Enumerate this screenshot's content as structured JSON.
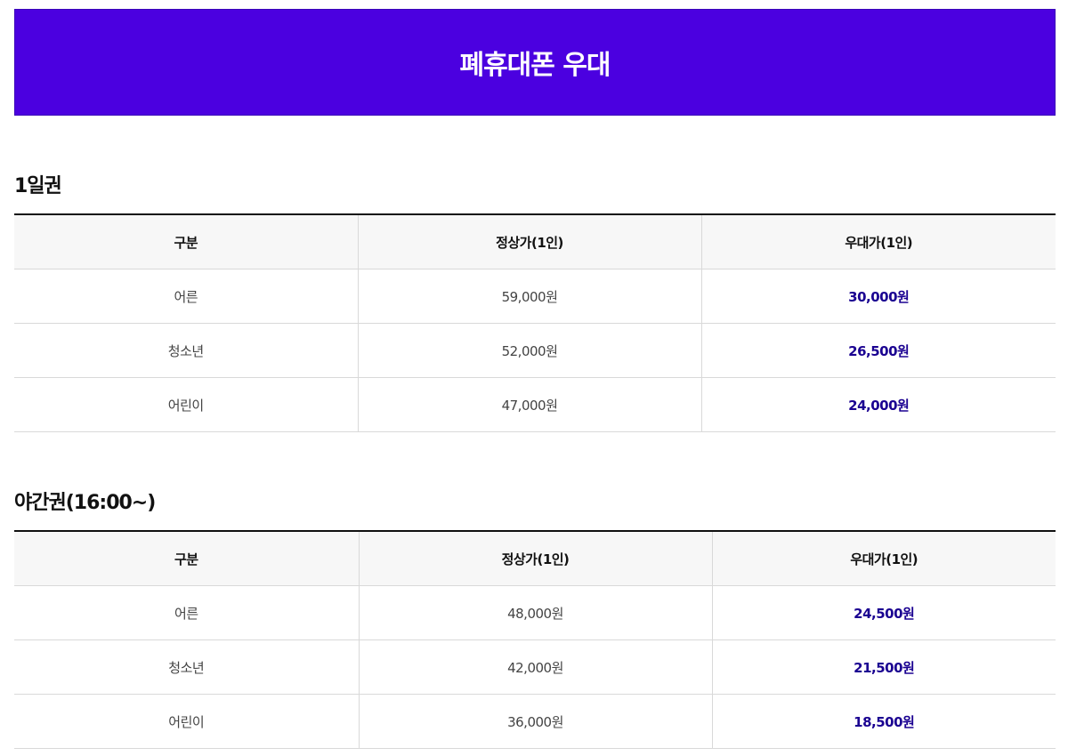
{
  "banner": {
    "title": "폐휴대폰 우대",
    "color": "#4b00e0"
  },
  "colors": {
    "sale_price": "#1a0091"
  },
  "sections": [
    {
      "title": "1일권",
      "headers": [
        "구분",
        "정상가(1인)",
        "우대가(1인)"
      ],
      "rows": [
        [
          "어른",
          "59,000원",
          "30,000원"
        ],
        [
          "청소년",
          "52,000원",
          "26,500원"
        ],
        [
          "어린이",
          "47,000원",
          "24,000원"
        ]
      ]
    },
    {
      "title": "야간권(16:00~)",
      "headers": [
        "구분",
        "정상가(1인)",
        "우대가(1인)"
      ],
      "rows": [
        [
          "어른",
          "48,000원",
          "24,500원"
        ],
        [
          "청소년",
          "42,000원",
          "21,500원"
        ],
        [
          "어린이",
          "36,000원",
          "18,500원"
        ]
      ]
    }
  ]
}
